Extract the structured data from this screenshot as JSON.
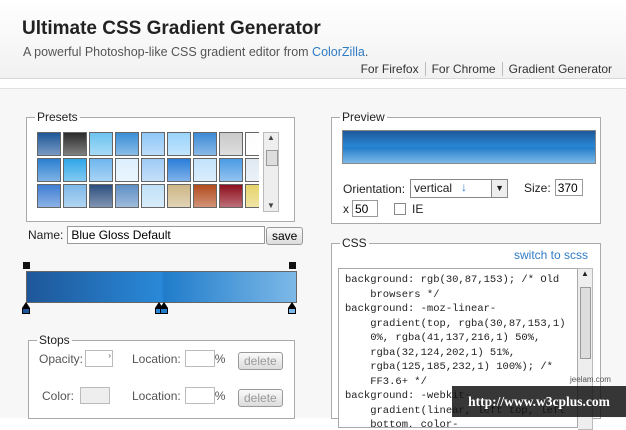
{
  "header": {
    "title": "Ultimate CSS Gradient Generator",
    "subtitle": "A powerful Photoshop-like CSS gradient editor from ",
    "subtitle_link": "ColorZilla",
    "subtitle_end": ".",
    "nav": [
      "For Firefox",
      "For Chrome",
      "Gradient Generator"
    ]
  },
  "presets": {
    "legend": "Presets",
    "swatches": [
      "#1e5799",
      "#2b2b2b",
      "#6cc3f0",
      "#3b8fd6",
      "#8fc6f7",
      "#9ad3fb",
      "#3c8ad6",
      "#c9c9c9",
      "#fdfdfd",
      "#2b7fd1",
      "#2fa6e8",
      "#6eb6ee",
      "#dceffd",
      "#9ecaf5",
      "#2a7ed9",
      "#c2e2fb",
      "#4b9be4",
      "#dfe9f2",
      "#3f7ed3",
      "#7db9e8",
      "#2d4f7f",
      "#5f8fc4",
      "#bfe0f7",
      "#cdb686",
      "#b24b1d",
      "#8e0e1d",
      "#e6d36b",
      "#3e9e35",
      "#8cc84b",
      "#4fae3d",
      "#a7d36b",
      "#5db84f",
      "#9dd367",
      "#86c654",
      "#b8dc84",
      "#6dbb44"
    ],
    "name_label": "Name:",
    "name_value": "Blue Gloss Default",
    "save_label": "save"
  },
  "stops": {
    "legend": "Stops",
    "opacity_label": "Opacity:",
    "color_label": "Color:",
    "location_label": "Location:",
    "percent": "%",
    "delete_label": "delete"
  },
  "preview": {
    "legend": "Preview",
    "orientation_label": "Orientation:",
    "orientation_value": "vertical",
    "orientation_arrow": "↓",
    "size_label": "Size:",
    "size_value": "370",
    "x_label": "x",
    "x_value": "50",
    "ie_label": "IE"
  },
  "css": {
    "legend": "CSS",
    "switch_link": "switch to scss",
    "code_lines": [
      "background: rgb(30,87,153); /* Old",
      "    browsers */",
      "background: -moz-linear-",
      "    gradient(top, rgba(30,87,153,1)",
      "    0%, rgba(41,137,216,1) 50%,",
      "    rgba(32,124,202,1) 51%,",
      "    rgba(125,185,232,1) 100%); /*",
      "    FF3.6+ */",
      "background: -webkit-",
      "    gradient(linear, left top, left",
      "    bottom, color-"
    ]
  },
  "watermark": {
    "text": "http://www.w3cplus.com",
    "small": "jeelam.com"
  },
  "colors": {
    "accent_link": "#2f7bc4",
    "gradient_start": "#1e5799",
    "gradient_mid1": "#2989d8",
    "gradient_mid2": "#207cca",
    "gradient_end": "#7db9e8"
  }
}
